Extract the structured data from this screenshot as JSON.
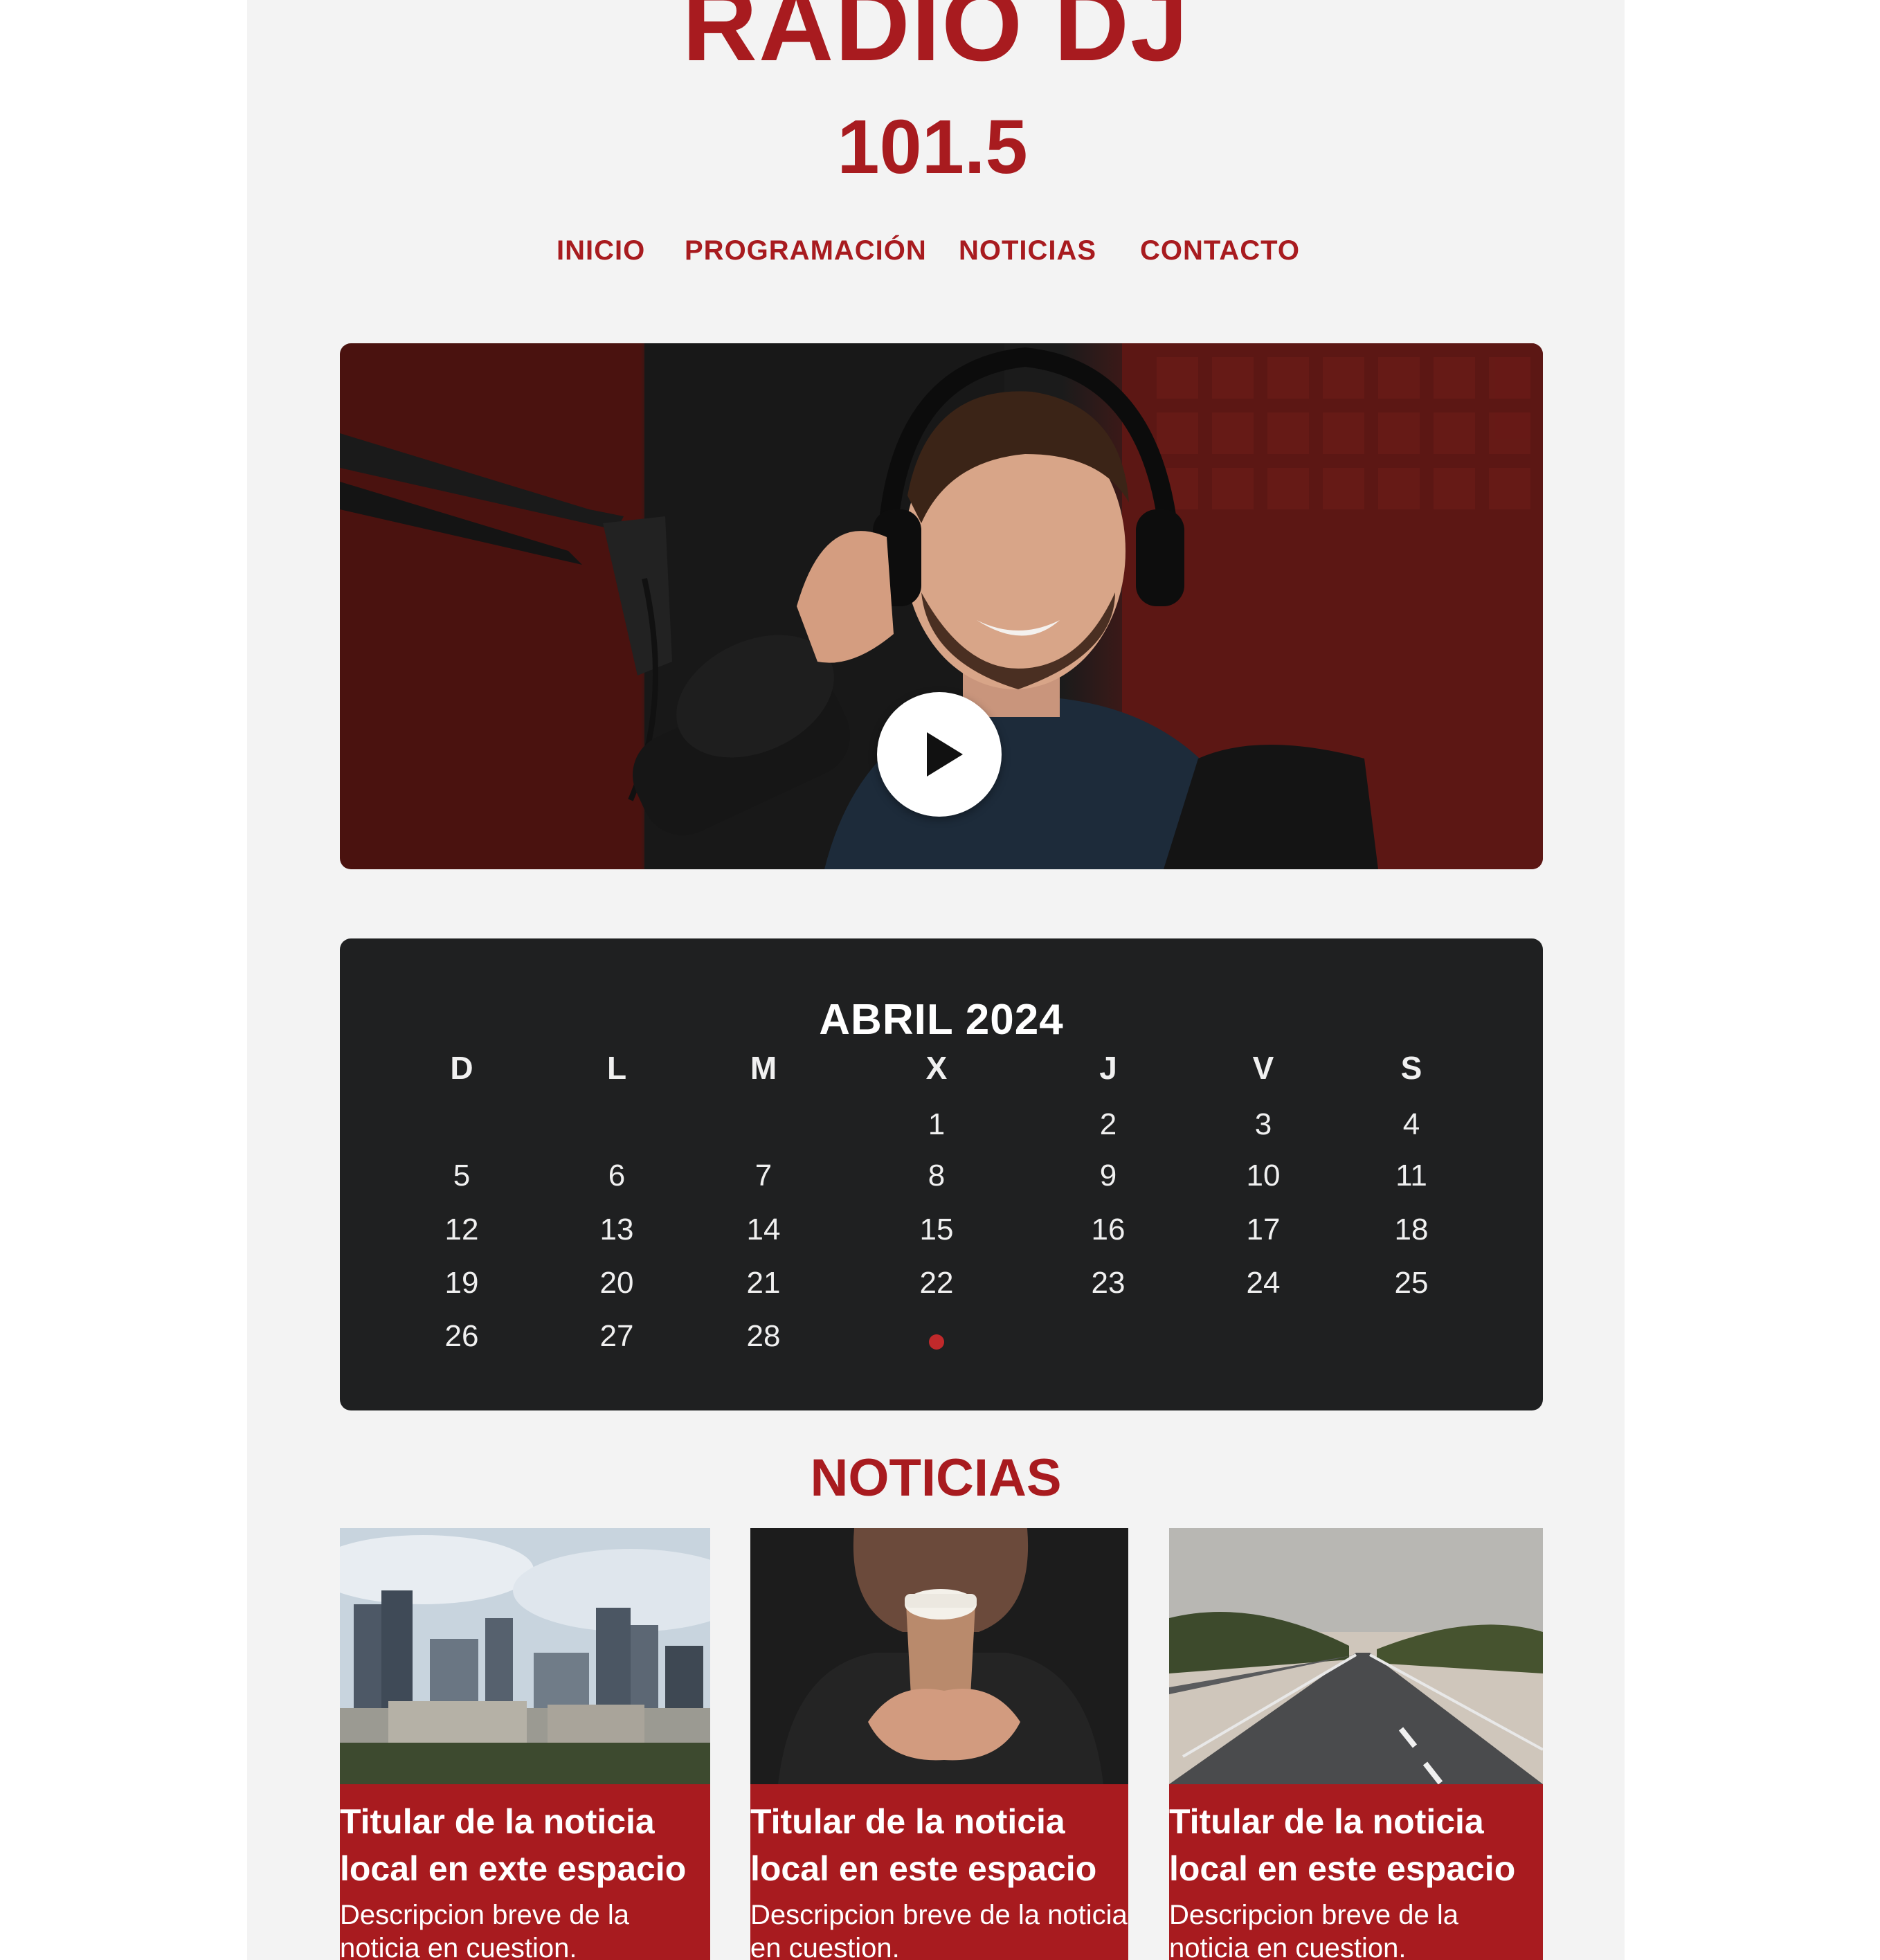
{
  "brand": {
    "name": "RADIO DJ",
    "frequency": "101.5",
    "accent": "#a81b1f"
  },
  "nav": [
    {
      "label": "INICIO"
    },
    {
      "label": "PROGRAMACIÓN"
    },
    {
      "label": "NOTICIAS"
    },
    {
      "label": "CONTACTO"
    }
  ],
  "hero": {
    "image": "dj-with-headphones-at-microphone",
    "play_icon": "play-icon"
  },
  "calendar": {
    "title": "ABRIL 2024",
    "weekdays": [
      "D",
      "L",
      "M",
      "X",
      "J",
      "V",
      "S"
    ],
    "weeks": [
      [
        "",
        "",
        "",
        "1",
        "2",
        "3",
        "4"
      ],
      [
        "5",
        "6",
        "7",
        "8",
        "9",
        "10",
        "11"
      ],
      [
        "12",
        "13",
        "14",
        "15",
        "16",
        "17",
        "18"
      ],
      [
        "19",
        "20",
        "21",
        "22",
        "23",
        "24",
        "25"
      ],
      [
        "26",
        "27",
        "28",
        "",
        "",
        "",
        ""
      ]
    ],
    "marker_color": "#c0292b"
  },
  "news": {
    "title": "NOTICIAS",
    "cards": [
      {
        "image": "city-skyline",
        "headline": "Titular de la noticia local en exte espacio",
        "description": "Descripcion breve de la noticia en cuestion."
      },
      {
        "image": "coffee-cup-hands",
        "headline": "Titular de la noticia local en este espacio",
        "description": "Descripcion breve de la noticia en cuestion."
      },
      {
        "image": "highway-road",
        "headline": "Titular de la noticia local en este espacio",
        "description": "Descripcion breve de la noticia en cuestion."
      }
    ]
  }
}
